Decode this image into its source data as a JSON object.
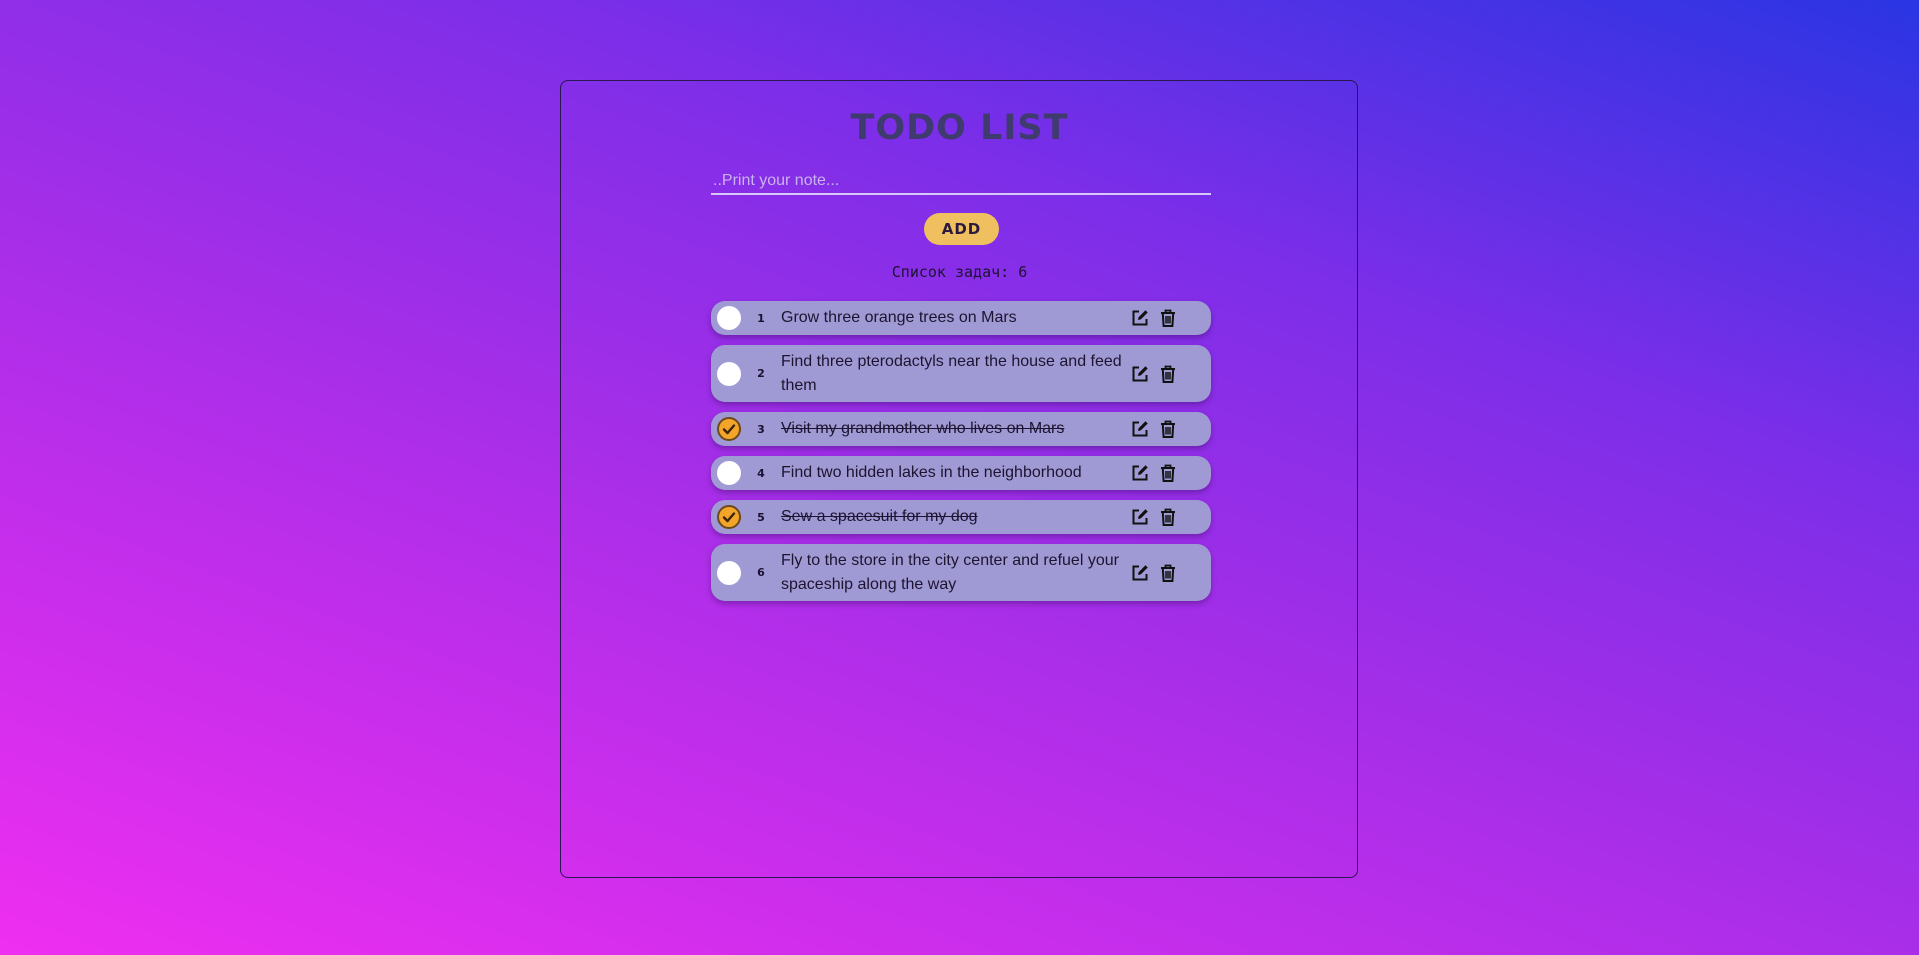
{
  "header": {
    "title": "TODO LIST"
  },
  "input": {
    "placeholder": "..Print your note..."
  },
  "add_button": {
    "label": "ADD"
  },
  "counter": {
    "text": "Список задач: 6"
  },
  "todos": [
    {
      "number": "1",
      "text": "Grow three orange trees on Mars",
      "done": false
    },
    {
      "number": "2",
      "text": "Find three pterodactyls near the house and feed them",
      "done": false
    },
    {
      "number": "3",
      "text": "Visit my grandmother who lives on Mars",
      "done": true
    },
    {
      "number": "4",
      "text": "Find two hidden lakes in the neighborhood",
      "done": false
    },
    {
      "number": "5",
      "text": "Sew a spacesuit for my dog",
      "done": true
    },
    {
      "number": "6",
      "text": "Fly to the store in the city center and refuel your spaceship along the way",
      "done": false
    }
  ],
  "icons": {
    "edit": "edit-icon",
    "delete": "trash-icon",
    "check": "checkmark-icon"
  },
  "colors": {
    "accent": "#f0c060",
    "item_background": "#a09ad4",
    "check_done": "#f3a42a",
    "title": "#3f3b6e"
  }
}
